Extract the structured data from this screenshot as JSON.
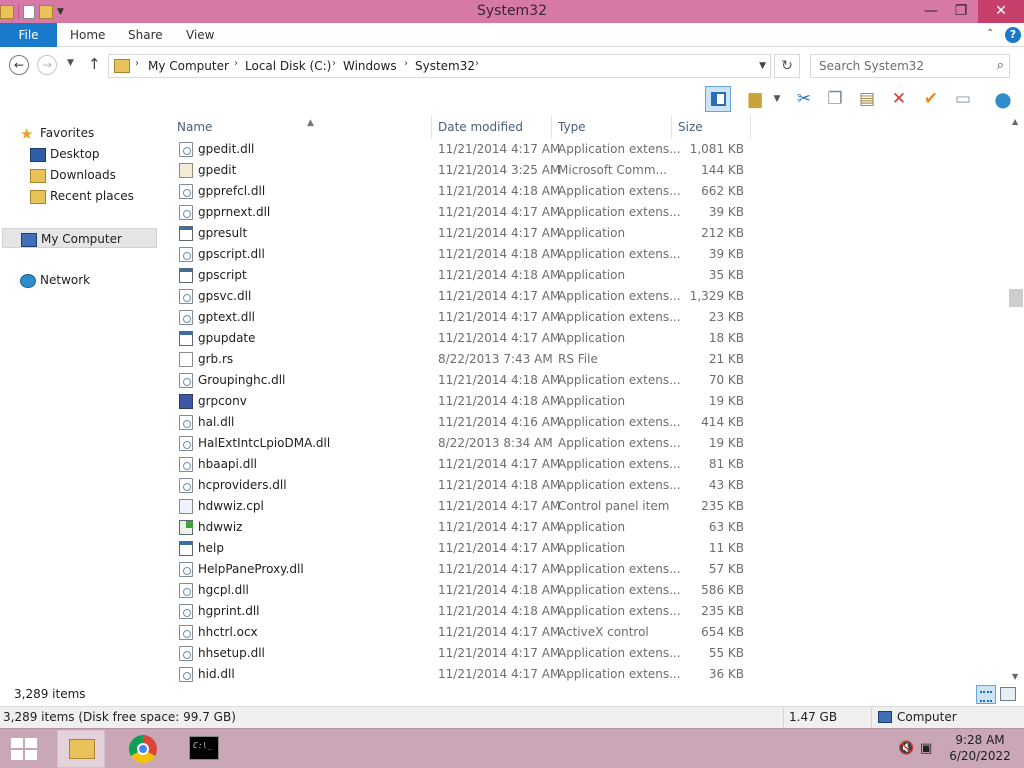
{
  "window": {
    "title": "System32",
    "minimize_glyph": "—",
    "maximize_glyph": "❐",
    "close_glyph": "✕"
  },
  "ribbon": {
    "tabs": [
      "File",
      "Home",
      "Share",
      "View"
    ],
    "help_glyph": "?"
  },
  "address": {
    "breadcrumbs": [
      "My Computer",
      "Local Disk (C:)",
      "Windows",
      "System32"
    ],
    "search_placeholder": "Search System32"
  },
  "toolbar": {
    "icons": [
      "preview-pane-icon",
      "new-folder-icon",
      "cut-icon",
      "copy-icon",
      "paste-icon",
      "delete-icon",
      "select-all-icon",
      "rename-icon",
      "internet-icon"
    ]
  },
  "navpane": {
    "favorites_label": "Favorites",
    "favorites": [
      "Desktop",
      "Downloads",
      "Recent places"
    ],
    "computer_label": "My Computer",
    "network_label": "Network"
  },
  "columns": {
    "name": "Name",
    "date": "Date modified",
    "type": "Type",
    "size": "Size"
  },
  "files": [
    {
      "icon": "dll",
      "name": "gpedit.dll",
      "date": "11/21/2014 4:17 AM",
      "type": "Application extens...",
      "size": "1,081 KB"
    },
    {
      "icon": "msc",
      "name": "gpedit",
      "date": "11/21/2014 3:25 AM",
      "type": "Microsoft Comm...",
      "size": "144 KB"
    },
    {
      "icon": "dll",
      "name": "gpprefcl.dll",
      "date": "11/21/2014 4:18 AM",
      "type": "Application extens...",
      "size": "662 KB"
    },
    {
      "icon": "dll",
      "name": "gpprnext.dll",
      "date": "11/21/2014 4:17 AM",
      "type": "Application extens...",
      "size": "39 KB"
    },
    {
      "icon": "app",
      "name": "gpresult",
      "date": "11/21/2014 4:17 AM",
      "type": "Application",
      "size": "212 KB"
    },
    {
      "icon": "dll",
      "name": "gpscript.dll",
      "date": "11/21/2014 4:18 AM",
      "type": "Application extens...",
      "size": "39 KB"
    },
    {
      "icon": "app",
      "name": "gpscript",
      "date": "11/21/2014 4:18 AM",
      "type": "Application",
      "size": "35 KB"
    },
    {
      "icon": "dll",
      "name": "gpsvc.dll",
      "date": "11/21/2014 4:17 AM",
      "type": "Application extens...",
      "size": "1,329 KB"
    },
    {
      "icon": "dll",
      "name": "gptext.dll",
      "date": "11/21/2014 4:17 AM",
      "type": "Application extens...",
      "size": "23 KB"
    },
    {
      "icon": "app",
      "name": "gpupdate",
      "date": "11/21/2014 4:17 AM",
      "type": "Application",
      "size": "18 KB"
    },
    {
      "icon": "file",
      "name": "grb.rs",
      "date": "8/22/2013 7:43 AM",
      "type": "RS File",
      "size": "21 KB"
    },
    {
      "icon": "dll",
      "name": "Groupinghc.dll",
      "date": "11/21/2014 4:18 AM",
      "type": "Application extens...",
      "size": "70 KB"
    },
    {
      "icon": "grp",
      "name": "grpconv",
      "date": "11/21/2014 4:18 AM",
      "type": "Application",
      "size": "19 KB"
    },
    {
      "icon": "dll",
      "name": "hal.dll",
      "date": "11/21/2014 4:16 AM",
      "type": "Application extens...",
      "size": "414 KB"
    },
    {
      "icon": "dll",
      "name": "HalExtIntcLpioDMA.dll",
      "date": "8/22/2013 8:34 AM",
      "type": "Application extens...",
      "size": "19 KB"
    },
    {
      "icon": "dll",
      "name": "hbaapi.dll",
      "date": "11/21/2014 4:17 AM",
      "type": "Application extens...",
      "size": "81 KB"
    },
    {
      "icon": "dll",
      "name": "hcproviders.dll",
      "date": "11/21/2014 4:18 AM",
      "type": "Application extens...",
      "size": "43 KB"
    },
    {
      "icon": "cpl",
      "name": "hdwwiz.cpl",
      "date": "11/21/2014 4:17 AM",
      "type": "Control panel item",
      "size": "235 KB"
    },
    {
      "icon": "hdw",
      "name": "hdwwiz",
      "date": "11/21/2014 4:17 AM",
      "type": "Application",
      "size": "63 KB"
    },
    {
      "icon": "app",
      "name": "help",
      "date": "11/21/2014 4:17 AM",
      "type": "Application",
      "size": "11 KB"
    },
    {
      "icon": "dll",
      "name": "HelpPaneProxy.dll",
      "date": "11/21/2014 4:17 AM",
      "type": "Application extens...",
      "size": "57 KB"
    },
    {
      "icon": "dll",
      "name": "hgcpl.dll",
      "date": "11/21/2014 4:18 AM",
      "type": "Application extens...",
      "size": "586 KB"
    },
    {
      "icon": "dll",
      "name": "hgprint.dll",
      "date": "11/21/2014 4:18 AM",
      "type": "Application extens...",
      "size": "235 KB"
    },
    {
      "icon": "dll",
      "name": "hhctrl.ocx",
      "date": "11/21/2014 4:17 AM",
      "type": "ActiveX control",
      "size": "654 KB"
    },
    {
      "icon": "dll",
      "name": "hhsetup.dll",
      "date": "11/21/2014 4:17 AM",
      "type": "Application extens...",
      "size": "55 KB"
    },
    {
      "icon": "dll",
      "name": "hid.dll",
      "date": "11/21/2014 4:17 AM",
      "type": "Application extens...",
      "size": "36 KB"
    }
  ],
  "item_count": "3,289 items",
  "status": {
    "left": "3,289 items (Disk free space: 99.7 GB)",
    "size": "1.47 GB",
    "location": "Computer"
  },
  "taskbar": {
    "time": "9:28 AM",
    "date": "6/20/2022"
  },
  "colors": {
    "titlebar": "#d779a6",
    "file_tab": "#1979ca",
    "taskbar": "#c9a7b6"
  }
}
